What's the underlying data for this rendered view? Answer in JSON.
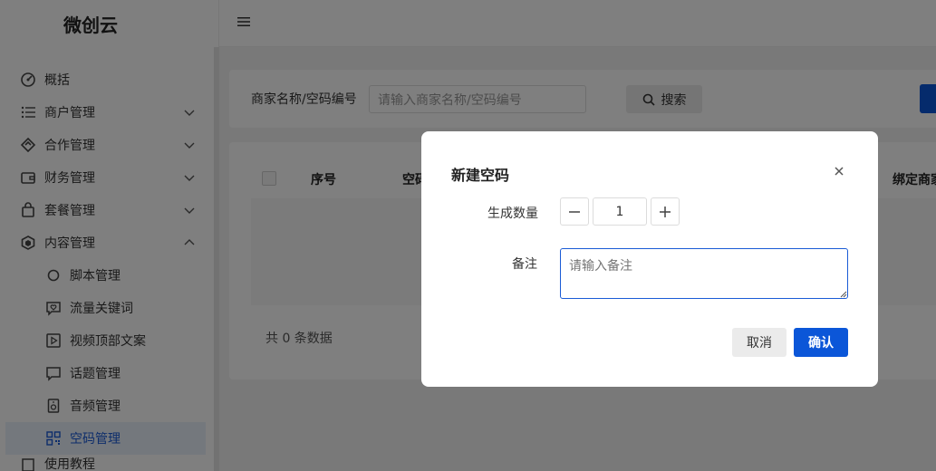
{
  "app": {
    "logo_text": "微创云"
  },
  "sidebar": {
    "items": [
      {
        "label": "概括",
        "icon": "dashboard-icon"
      },
      {
        "label": "商户管理",
        "icon": "list-icon",
        "expandable": true
      },
      {
        "label": "合作管理",
        "icon": "handshake-icon",
        "expandable": true
      },
      {
        "label": "财务管理",
        "icon": "wallet-icon",
        "expandable": true
      },
      {
        "label": "套餐管理",
        "icon": "bag-icon",
        "expandable": true
      },
      {
        "label": "内容管理",
        "icon": "content-icon",
        "expanded": true
      }
    ],
    "sub_items": [
      {
        "label": "脚本管理",
        "icon": "circle-icon"
      },
      {
        "label": "流量关键词",
        "icon": "heart-message-icon"
      },
      {
        "label": "视频顶部文案",
        "icon": "video-icon"
      },
      {
        "label": "话题管理",
        "icon": "message-icon"
      },
      {
        "label": "音频管理",
        "icon": "speaker-icon"
      },
      {
        "label": "空码管理",
        "icon": "qrcode-icon",
        "active": true
      }
    ],
    "partial_item": {
      "label": "使用教程"
    }
  },
  "filter": {
    "label": "商家名称/空码编号",
    "placeholder": "请输入商家名称/空码编号",
    "search_label": "搜索"
  },
  "table": {
    "columns": [
      "序号",
      "空码",
      "绑定商家"
    ],
    "total_text": "共 0 条数据"
  },
  "dialog": {
    "title": "新建空码",
    "quantity_label": "生成数量",
    "quantity_value": "1",
    "note_label": "备注",
    "note_placeholder": "请输入备注",
    "cancel_label": "取消",
    "confirm_label": "确认"
  },
  "colors": {
    "primary": "#0b56d8",
    "active_bg": "#e9f0fb"
  }
}
